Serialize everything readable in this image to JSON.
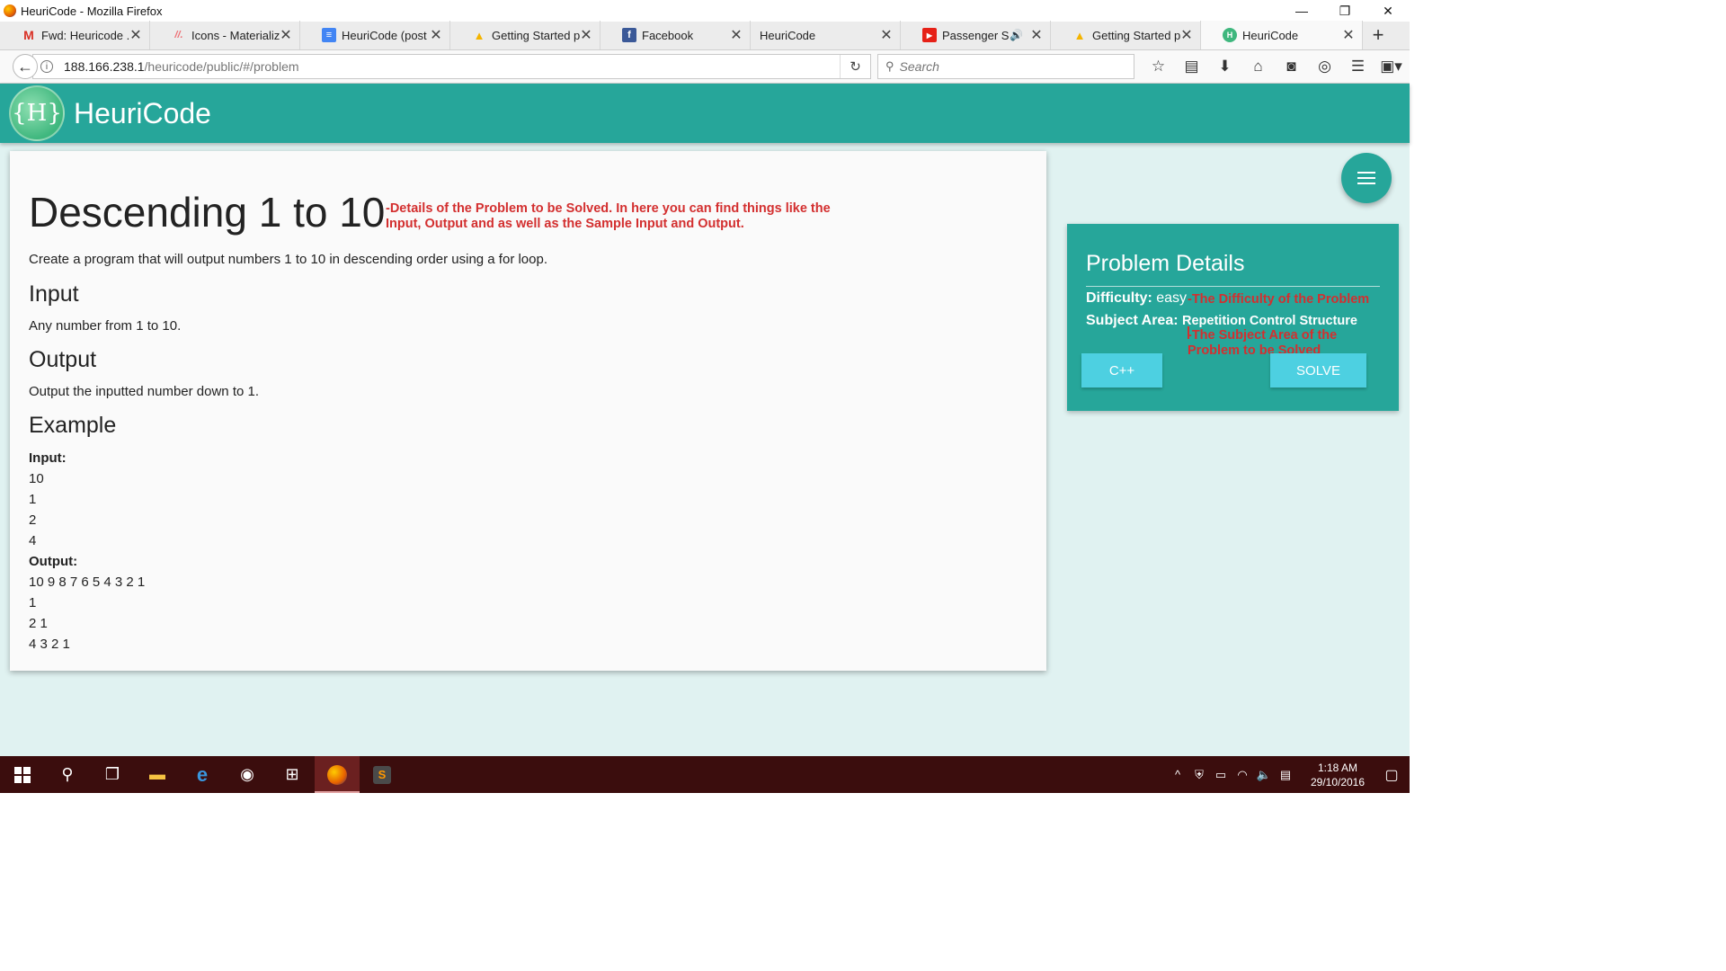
{
  "window": {
    "title": "HeuriCode - Mozilla Firefox",
    "controls": {
      "minimize": "—",
      "restore": "❐",
      "close": "✕"
    }
  },
  "tabs": [
    {
      "label": "Fwd: Heuricode ...",
      "icon": "gmail-icon",
      "icon_glyph": "M",
      "icon_color": "#d93025"
    },
    {
      "label": "Icons - Materialize",
      "icon": "materialize-icon",
      "icon_glyph": "//.",
      "icon_color": "#ee6e73"
    },
    {
      "label": "HeuriCode (post ...",
      "icon": "google-docs-icon",
      "icon_glyph": "≡",
      "icon_color": "#4285f4"
    },
    {
      "label": "Getting Started p...",
      "icon": "google-drive-icon",
      "icon_glyph": "▲",
      "icon_color": "#f4b400"
    },
    {
      "label": "Facebook",
      "icon": "facebook-icon",
      "icon_glyph": "f",
      "icon_color": "#3b5998"
    },
    {
      "label": "HeuriCode",
      "icon": "",
      "icon_glyph": "",
      "icon_color": ""
    },
    {
      "label": "Passenger Se...",
      "icon": "youtube-icon",
      "icon_glyph": "▶",
      "icon_color": "#e62117",
      "audio": true
    },
    {
      "label": "Getting Started p...",
      "icon": "google-drive-icon",
      "icon_glyph": "▲",
      "icon_color": "#f4b400"
    },
    {
      "label": "HeuriCode",
      "icon": "heuricode-favicon",
      "icon_glyph": "H",
      "icon_color": "#3fb77e",
      "active": true
    }
  ],
  "nav": {
    "url_host": "188.166.238.1",
    "url_path": "/heuricode/public/#/problem",
    "search_placeholder": "Search"
  },
  "app": {
    "logo_text": "{H}",
    "name": "HeuriCode",
    "accent_color": "#26a69a"
  },
  "problem": {
    "title": "Descending 1 to 10",
    "title_note": "-Details of the Problem to be Solved. In here you can find things like the Input, Output and as well as the Sample Input and Output.",
    "description": "Create a program that will output numbers 1 to 10 in descending order using a for loop.",
    "input_heading": "Input",
    "input_text": "Any number from 1 to 10.",
    "output_heading": "Output",
    "output_text": "Output the inputted number down to 1.",
    "example_heading": "Example",
    "example_input_label": "Input:",
    "example_inputs": [
      "10",
      "1",
      "2",
      "4"
    ],
    "example_output_label": "Output:",
    "example_outputs": [
      "10 9 8 7 6 5 4 3 2 1",
      "1",
      "2 1",
      "4 3 2 1"
    ]
  },
  "details": {
    "title": "Problem Details",
    "difficulty_label": "Difficulty:",
    "difficulty_value": "easy",
    "difficulty_note": "-The Difficulty of the Problem",
    "subject_label": "Subject Area:",
    "subject_value": "Repetition Control Structure",
    "subject_note": "-The Subject Area of the Problem to be Solved",
    "language_button": "C++",
    "solve_button": "SOLVE",
    "note_color": "#d32f2f"
  },
  "taskbar": {
    "time": "1:18 AM",
    "date": "29/10/2016"
  }
}
